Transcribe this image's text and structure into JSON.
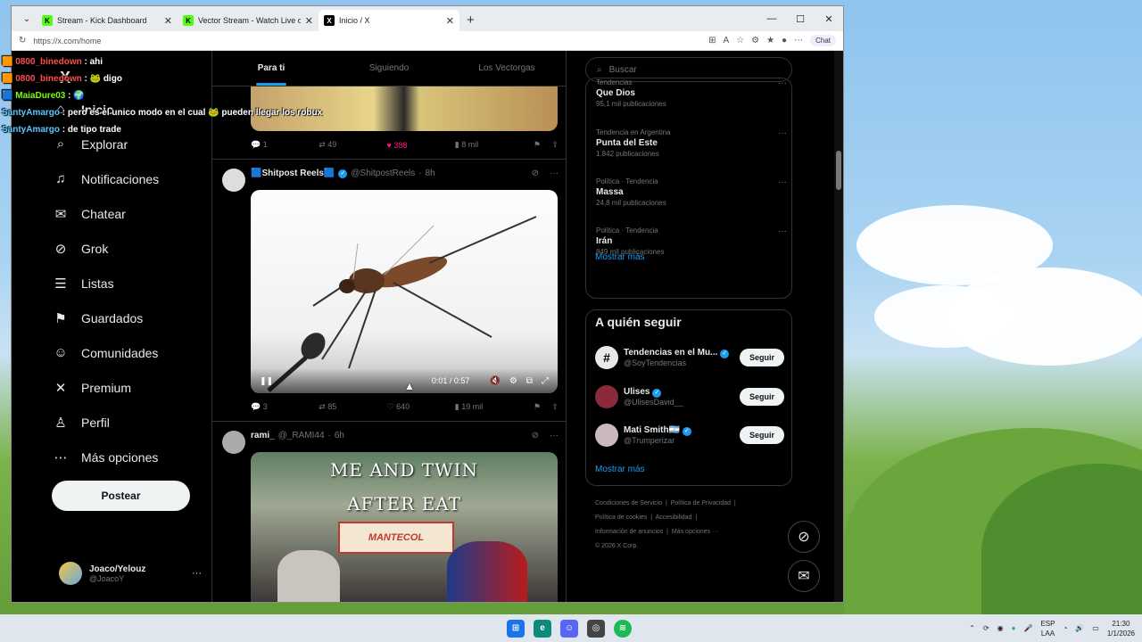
{
  "browser": {
    "tabs": [
      {
        "label": "Stream - Kick Dashboard",
        "icon": "kick-icon"
      },
      {
        "label": "Vector Stream - Watch Live on Kick",
        "icon": "kick-icon"
      },
      {
        "label": "Inicio / X",
        "icon": "x-logo-icon"
      }
    ],
    "url": "https://x.com/home",
    "copilot_label": "Chat"
  },
  "stream_chat": [
    {
      "user": "0800_binedown",
      "text": "ahi",
      "color": "#ff4d4d"
    },
    {
      "user": "0800_binedown",
      "text": "digo",
      "color": "#ff4d4d"
    },
    {
      "user": "MaiaDure03",
      "text": "",
      "color": "#7cfc00"
    },
    {
      "user": "SantyAmargo",
      "text": "pero es el unico modo en el cual",
      "extra": "pueden llegar los robux",
      "color": "#5bc8ff"
    },
    {
      "user": "SantyAmargo",
      "text": "de tipo trade",
      "color": "#5bc8ff"
    }
  ],
  "sidebar": {
    "items": [
      {
        "label": "Inicio",
        "icon": "home-icon",
        "glyph": "⌂"
      },
      {
        "label": "Explorar",
        "icon": "search-icon",
        "glyph": "⌕"
      },
      {
        "label": "Notificaciones",
        "icon": "bell-icon",
        "glyph": "♫"
      },
      {
        "label": "Chatear",
        "icon": "mail-icon",
        "glyph": "✉"
      },
      {
        "label": "Grok",
        "icon": "grok-icon",
        "glyph": "⊘"
      },
      {
        "label": "Listas",
        "icon": "list-icon",
        "glyph": "☰"
      },
      {
        "label": "Guardados",
        "icon": "bookmark-icon",
        "glyph": "⚑"
      },
      {
        "label": "Comunidades",
        "icon": "people-icon",
        "glyph": "☺"
      },
      {
        "label": "Premium",
        "icon": "x-logo-icon",
        "glyph": "✕"
      },
      {
        "label": "Perfil",
        "icon": "person-icon",
        "glyph": "♙"
      },
      {
        "label": "Más opciones",
        "icon": "more-circle-icon",
        "glyph": "⋯"
      }
    ],
    "post_button": "Postear",
    "profile": {
      "name": "Joaco/Yelouz",
      "handle": "@JoacoY"
    }
  },
  "feed": {
    "tabs": [
      "Para ti",
      "Siguiendo",
      "Los Vectorgas"
    ],
    "post1_stats": {
      "replies": "1",
      "reposts": "49",
      "likes": "388",
      "views": "8 mil"
    },
    "post2": {
      "name": "🟦Shitpost Reels🟦",
      "handle": "@ShitpostReels",
      "time": "8h",
      "video_time": "0:01 / 0:57",
      "video_progress": 0.018,
      "stats": {
        "replies": "3",
        "reposts": "85",
        "likes": "640",
        "views": "19 mil"
      }
    },
    "post3": {
      "name": "rami_",
      "handle": "@_RAMI44",
      "time": "6h",
      "meme_line1": "ME AND TWIN",
      "meme_line2": "AFTER EAT",
      "product": "MANTECOL"
    }
  },
  "right": {
    "search_placeholder": "Buscar",
    "trends": [
      {
        "context": "Tendencias",
        "title": "Que Dios",
        "count": "95,1 mil publicaciones"
      },
      {
        "context": "Tendencia en Argentina",
        "title": "Punta del Este",
        "count": "1.842 publicaciones"
      },
      {
        "context": "Política · Tendencia",
        "title": "Massa",
        "count": "24,8 mil publicaciones"
      },
      {
        "context": "Política · Tendencia",
        "title": "Irán",
        "count": "849 mil publicaciones"
      }
    ],
    "show_more": "Mostrar más",
    "who_to_follow_title": "A quién seguir",
    "follow": [
      {
        "name": "Tendencias en el Mu...",
        "handle": "@SoyTendencias",
        "button": "Seguir"
      },
      {
        "name": "Ulises",
        "handle": "@UlisesDavid__",
        "button": "Seguir"
      },
      {
        "name": "Mati Smith🇦🇷",
        "handle": "@Trumperizar",
        "button": "Seguir"
      }
    ],
    "show_more2": "Mostrar más",
    "footer": {
      "line1a": "Condiciones de Servicio",
      "line1b": "Política de Privacidad",
      "line2a": "Política de cookies",
      "line2b": "Accesibilidad",
      "line3a": "Información de anuncios",
      "line3b": "Más opciones ···",
      "line4": "© 2026 X Corp."
    }
  },
  "taskbar": {
    "lang1": "ESP",
    "lang2": "LAA",
    "time": "21:30",
    "date": "1/1/2026"
  }
}
